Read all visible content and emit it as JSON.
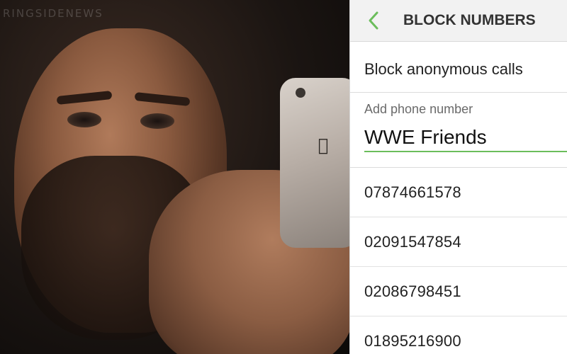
{
  "watermark": "RINGSIDENEWS",
  "header": {
    "title": "BLOCK NUMBERS",
    "back_icon": "chevron-left-icon",
    "accent_color": "#6bbd5b"
  },
  "anonymous": {
    "label": "Block anonymous calls"
  },
  "add_number": {
    "label": "Add phone number",
    "value": "WWE Friends"
  },
  "blocked_numbers": [
    "07874661578",
    "02091547854",
    "02086798451",
    "01895216900"
  ]
}
